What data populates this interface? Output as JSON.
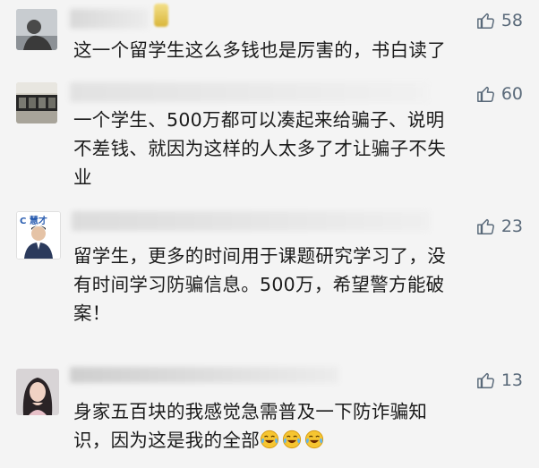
{
  "comments": [
    {
      "avatar_name": "avatar-person-icon",
      "likes": "58",
      "lines": [
        "这一个留学生这么多钱也是厉害的，书白读了"
      ]
    },
    {
      "avatar_name": "avatar-storefront-icon",
      "likes": "60",
      "lines": [
        "一个学生、500万都可以凑起来给骗子、说明",
        "不差钱、就因为这样的人太多了才让骗子不失",
        "业"
      ]
    },
    {
      "avatar_name": "avatar-man-suit-icon",
      "avatar_badge": "C 慧才",
      "likes": "23",
      "lines": [
        "留学生，更多的时间用于课题研究学习了，没",
        "有时间学习防骗信息。500万，希望警方能破",
        "案！"
      ]
    },
    {
      "avatar_name": "avatar-woman-icon",
      "likes": "13",
      "lines": [
        "身家五百块的我感觉急需普及一下防诈骗知",
        "识，因为这是我的全部"
      ],
      "emojis": [
        "crying-laughing-emoji",
        "crying-laughing-emoji",
        "crying-laughing-emoji"
      ]
    }
  ],
  "colors": {
    "like": "#5a6a7a",
    "text": "#1b1b1b",
    "background": "#f4f4f4"
  }
}
